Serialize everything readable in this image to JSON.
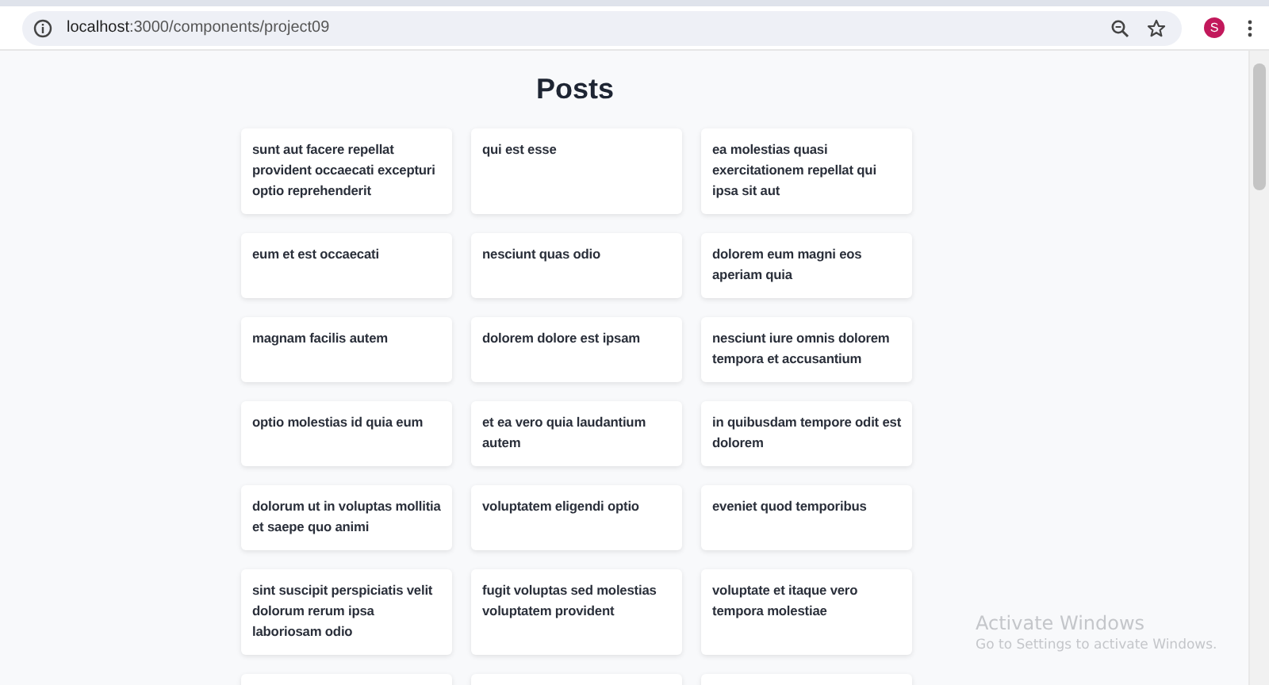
{
  "browser": {
    "url_host": "localhost",
    "url_path": ":3000/components/project09",
    "profile_initial": "S"
  },
  "page": {
    "title": "Posts"
  },
  "posts": [
    {
      "kind": "post",
      "title": "sunt aut facere repellat provident occaecati excepturi optio reprehenderit"
    },
    {
      "kind": "post",
      "title": "qui est esse"
    },
    {
      "kind": "post",
      "title": "ea molestias quasi exercitationem repellat qui ipsa sit aut"
    },
    {
      "kind": "post",
      "title": "eum et est occaecati"
    },
    {
      "kind": "post",
      "title": "nesciunt quas odio"
    },
    {
      "kind": "post",
      "title": "dolorem eum magni eos aperiam quia"
    },
    {
      "kind": "post",
      "title": "magnam facilis autem"
    },
    {
      "kind": "post",
      "title": "dolorem dolore est ipsam"
    },
    {
      "kind": "post",
      "title": "nesciunt iure omnis dolorem tempora et accusantium"
    },
    {
      "kind": "post",
      "title": "optio molestias id quia eum"
    },
    {
      "kind": "post",
      "title": "et ea vero quia laudantium autem"
    },
    {
      "kind": "post",
      "title": "in quibusdam tempore odit est dolorem"
    },
    {
      "kind": "post",
      "title": "dolorum ut in voluptas mollitia et saepe quo animi"
    },
    {
      "kind": "post",
      "title": "voluptatem eligendi optio"
    },
    {
      "kind": "post",
      "title": "eveniet quod temporibus"
    },
    {
      "kind": "post",
      "title": "sint suscipit perspiciatis velit dolorum rerum ipsa laboriosam odio"
    },
    {
      "kind": "post",
      "title": "fugit voluptas sed molestias voluptatem provident"
    },
    {
      "kind": "post",
      "title": "voluptate et itaque vero tempora molestiae"
    },
    {
      "kind": "cut-off"
    },
    {
      "kind": "cut-off"
    },
    {
      "kind": "cut-off"
    }
  ],
  "os_overlay": {
    "title": "Activate Windows",
    "subtitle": "Go to Settings to activate Windows."
  }
}
